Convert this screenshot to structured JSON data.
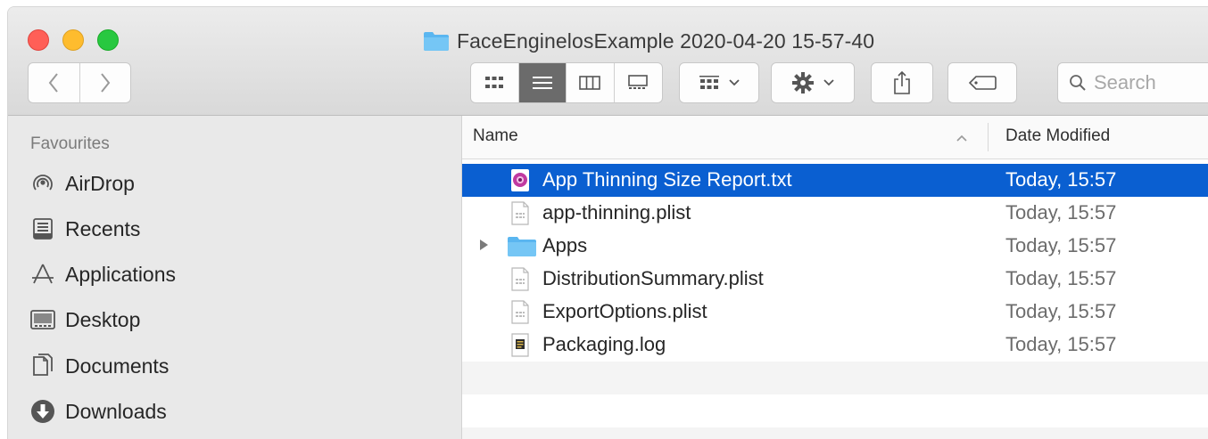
{
  "window": {
    "title": "FaceEnginelosExample 2020-04-20 15-57-40"
  },
  "toolbar": {
    "back_icon": "chevron-left-icon",
    "forward_icon": "chevron-right-icon",
    "views": [
      "icon-view",
      "list-view",
      "column-view",
      "gallery-view"
    ],
    "active_view": "list-view",
    "search_placeholder": "Search"
  },
  "sidebar": {
    "header": "Favourites",
    "items": [
      {
        "label": "AirDrop",
        "icon": "airdrop-icon"
      },
      {
        "label": "Recents",
        "icon": "recents-icon"
      },
      {
        "label": "Applications",
        "icon": "applications-icon"
      },
      {
        "label": "Desktop",
        "icon": "desktop-icon"
      },
      {
        "label": "Documents",
        "icon": "documents-icon"
      },
      {
        "label": "Downloads",
        "icon": "downloads-icon"
      }
    ]
  },
  "list": {
    "columns": {
      "name": "Name",
      "date": "Date Modified"
    },
    "rows": [
      {
        "name": "App Thinning Size Report.txt",
        "date": "Today, 15:57",
        "icon": "txt-file-icon",
        "selected": true
      },
      {
        "name": "app-thinning.plist",
        "date": "Today, 15:57",
        "icon": "plist-file-icon"
      },
      {
        "name": "Apps",
        "date": "Today, 15:57",
        "icon": "folder-icon",
        "folder": true
      },
      {
        "name": "DistributionSummary.plist",
        "date": "Today, 15:57",
        "icon": "plist-file-icon"
      },
      {
        "name": "ExportOptions.plist",
        "date": "Today, 15:57",
        "icon": "plist-file-icon"
      },
      {
        "name": "Packaging.log",
        "date": "Today, 15:57",
        "icon": "log-file-icon"
      }
    ]
  },
  "colors": {
    "selection": "#0a5fd1",
    "folder": "#5ab6f0",
    "sidebar_bg": "#e9e9e9"
  }
}
